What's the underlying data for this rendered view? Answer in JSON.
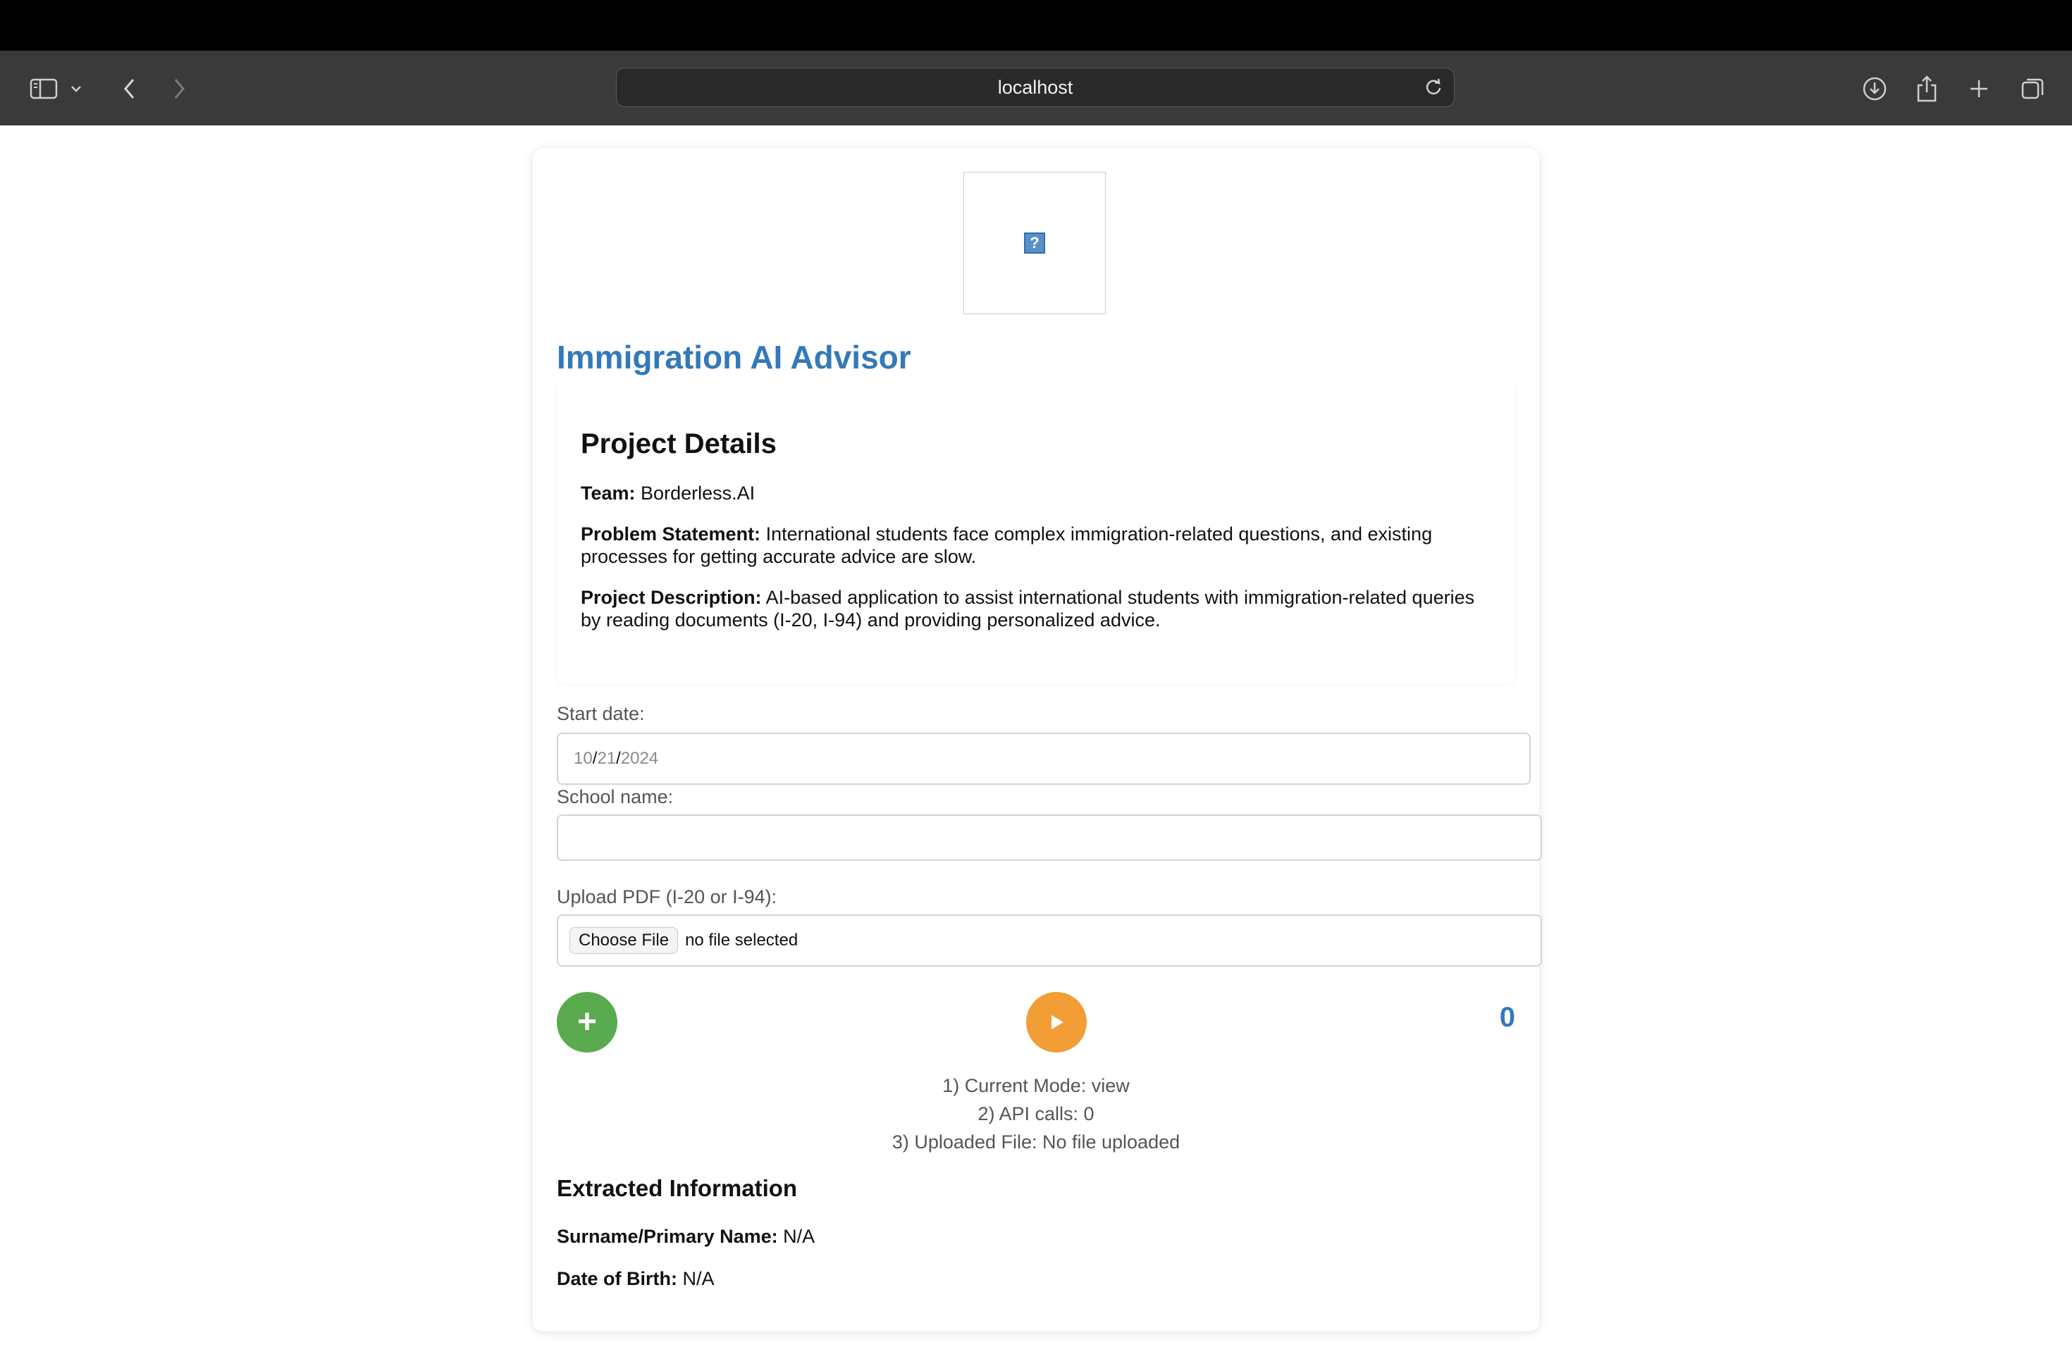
{
  "browser": {
    "url": "localhost"
  },
  "page": {
    "title": "Immigration AI Advisor",
    "logo_placeholder": "?",
    "details": {
      "heading": "Project Details",
      "team_label": "Team:",
      "team_value": "Borderless.AI",
      "problem_label": "Problem Statement:",
      "problem_value": "International students face complex immigration-related questions, and existing processes for getting accurate advice are slow.",
      "description_label": "Project Description:",
      "description_value": "AI-based application to assist international students with immigration-related queries by reading documents (I-20, I-94) and providing personalized advice."
    },
    "form": {
      "start_date_label": "Start date:",
      "start_date_month": "10",
      "start_date_day": "21",
      "start_date_year": "2024",
      "date_separator": "/",
      "school_label": "School name:",
      "school_value": "",
      "upload_label": "Upload PDF (I-20 or I-94):",
      "choose_file_label": "Choose File",
      "no_file_text": "no file selected"
    },
    "controls": {
      "add_symbol": "+",
      "counter": "0"
    },
    "status": {
      "mode": "1) Current Mode: view",
      "api_calls": "2) API calls: 0",
      "uploaded_file": "3) Uploaded File: No file uploaded"
    },
    "extracted": {
      "heading": "Extracted Information",
      "surname_label": "Surname/Primary Name:",
      "surname_value": "N/A",
      "dob_label": "Date of Birth:",
      "dob_value": "N/A"
    }
  },
  "colors": {
    "title": "#3479b9",
    "add_button": "#5aaa4f",
    "play_button": "#f29d35",
    "counter": "#3479b9"
  },
  "icons": [
    "sidebar-icon",
    "chevron-down-icon",
    "back-icon",
    "forward-icon",
    "reload-icon",
    "download-icon",
    "share-icon",
    "new-tab-icon",
    "tab-overview-icon",
    "plus-icon",
    "play-icon"
  ]
}
